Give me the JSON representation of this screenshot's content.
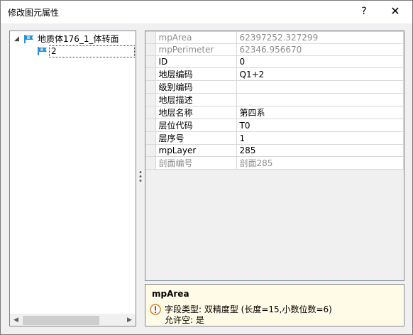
{
  "window": {
    "title": "修改图元属性",
    "help_label": "?",
    "close_label": "✕"
  },
  "tree": {
    "root": {
      "label": "地质体176_1_体转面",
      "expander": "◢"
    },
    "child": {
      "label": "2"
    }
  },
  "properties": [
    {
      "name": "mpArea",
      "value": "62397252.327299",
      "readonly": true
    },
    {
      "name": "mpPerimeter",
      "value": "62346.956670",
      "readonly": true
    },
    {
      "name": "ID",
      "value": "0",
      "readonly": false
    },
    {
      "name": "地层编码",
      "value": "Q1+2",
      "readonly": false
    },
    {
      "name": "级别编码",
      "value": "",
      "readonly": false
    },
    {
      "name": "地层描述",
      "value": "",
      "readonly": false
    },
    {
      "name": "地层名称",
      "value": "第四系",
      "readonly": false
    },
    {
      "name": "层位代码",
      "value": "T0",
      "readonly": false
    },
    {
      "name": "层序号",
      "value": "1",
      "readonly": false
    },
    {
      "name": "mpLayer",
      "value": "285",
      "readonly": false
    },
    {
      "name": "剖面编号",
      "value": "剖面285",
      "readonly": true
    }
  ],
  "help": {
    "title": "mpArea",
    "line1": "字段类型: 双精度型 (长度=15,小数位数=6)",
    "line2": "允许空: 是",
    "icon": "info-warning-icon"
  },
  "colors": {
    "help_background": "#fffbe6",
    "readonly_text": "#8d8d8d",
    "flag_icon": "#2a8fd6"
  }
}
